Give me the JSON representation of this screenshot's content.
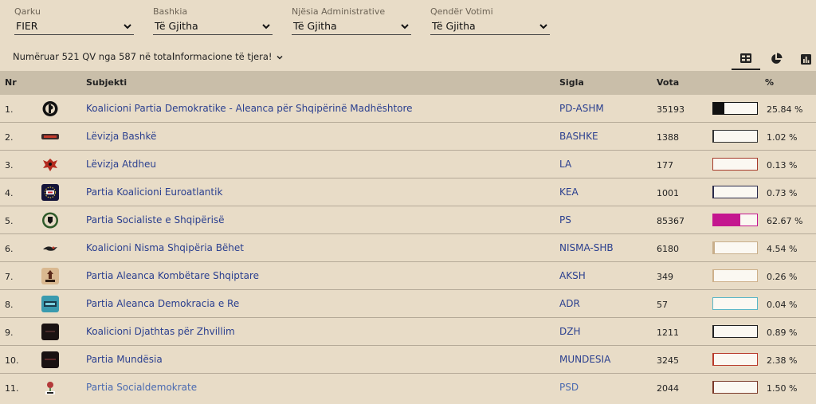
{
  "filters": [
    {
      "label": "Qarku",
      "value": "FIER"
    },
    {
      "label": "Bashkia",
      "value": "Të Gjitha"
    },
    {
      "label": "Njësia Administrative",
      "value": "Të Gjitha"
    },
    {
      "label": "Qendër Votimi",
      "value": "Të Gjitha"
    }
  ],
  "summary": "Numëruar 521 QV nga 587 në total",
  "more_info": "Informacione të tjera!",
  "views": [
    "table-icon",
    "pie-chart-icon",
    "bar-chart-icon"
  ],
  "columns": {
    "nr": "Nr",
    "subjekti": "Subjekti",
    "sigla": "Sigla",
    "vota": "Vota",
    "pct": "%"
  },
  "rows": [
    {
      "nr": "1.",
      "subjekti": "Koalicioni Partia Demokratike - Aleanca për Shqipërinë Madhështore",
      "sigla": "PD-ASHM",
      "vota": "35193",
      "pct": "25.84 %",
      "share": 0.2584,
      "color": "#111111",
      "logo": "pd-logo"
    },
    {
      "nr": "2.",
      "subjekti": "Lëvizja Bashkë",
      "sigla": "BASHKE",
      "vota": "1388",
      "pct": "1.02 %",
      "share": 0.0102,
      "color": "#333333",
      "logo": "bashke-logo"
    },
    {
      "nr": "3.",
      "subjekti": "Lëvizja Atdheu",
      "sigla": "LA",
      "vota": "177",
      "pct": "0.13 %",
      "share": 0.0013,
      "color": "#a63a2a",
      "logo": "la-logo"
    },
    {
      "nr": "4.",
      "subjekti": "Partia Koalicioni Euroatlantik",
      "sigla": "KEA",
      "vota": "1001",
      "pct": "0.73 %",
      "share": 0.0073,
      "color": "#2a2a4a",
      "logo": "kea-logo"
    },
    {
      "nr": "5.",
      "subjekti": "Partia Socialiste e Shqipërisë",
      "sigla": "PS",
      "vota": "85367",
      "pct": "62.67 %",
      "share": 0.6267,
      "color": "#c4168f",
      "logo": "ps-logo"
    },
    {
      "nr": "6.",
      "subjekti": "Koalicioni Nisma Shqipëria Bëhet",
      "sigla": "NISMA-SHB",
      "vota": "6180",
      "pct": "4.54 %",
      "share": 0.0454,
      "color": "#c8ae8a",
      "logo": "nisma-logo"
    },
    {
      "nr": "7.",
      "subjekti": "Partia Aleanca Kombëtare Shqiptare",
      "sigla": "AKSH",
      "vota": "349",
      "pct": "0.26 %",
      "share": 0.0026,
      "color": "#cdb08a",
      "logo": "aksh-logo"
    },
    {
      "nr": "8.",
      "subjekti": "Partia Aleanca Demokracia e Re",
      "sigla": "ADR",
      "vota": "57",
      "pct": "0.04 %",
      "share": 0.0004,
      "color": "#5ab6c6",
      "logo": "adr-logo"
    },
    {
      "nr": "9.",
      "subjekti": "Koalicioni Djathtas për Zhvillim",
      "sigla": "DZH",
      "vota": "1211",
      "pct": "0.89 %",
      "share": 0.0089,
      "color": "#222222",
      "logo": "dzh-logo"
    },
    {
      "nr": "10.",
      "subjekti": "Partia Mundësia",
      "sigla": "MUNDESIA",
      "vota": "3245",
      "pct": "2.38 %",
      "share": 0.0238,
      "color": "#b83a2a",
      "logo": "mundesia-logo"
    },
    {
      "nr": "11.",
      "subjekti": "Partia Socialdemokrate",
      "sigla": "PSD",
      "vota": "2044",
      "pct": "1.50 %",
      "share": 0.015,
      "color": "#7a3a2a",
      "logo": "psd-logo"
    }
  ]
}
